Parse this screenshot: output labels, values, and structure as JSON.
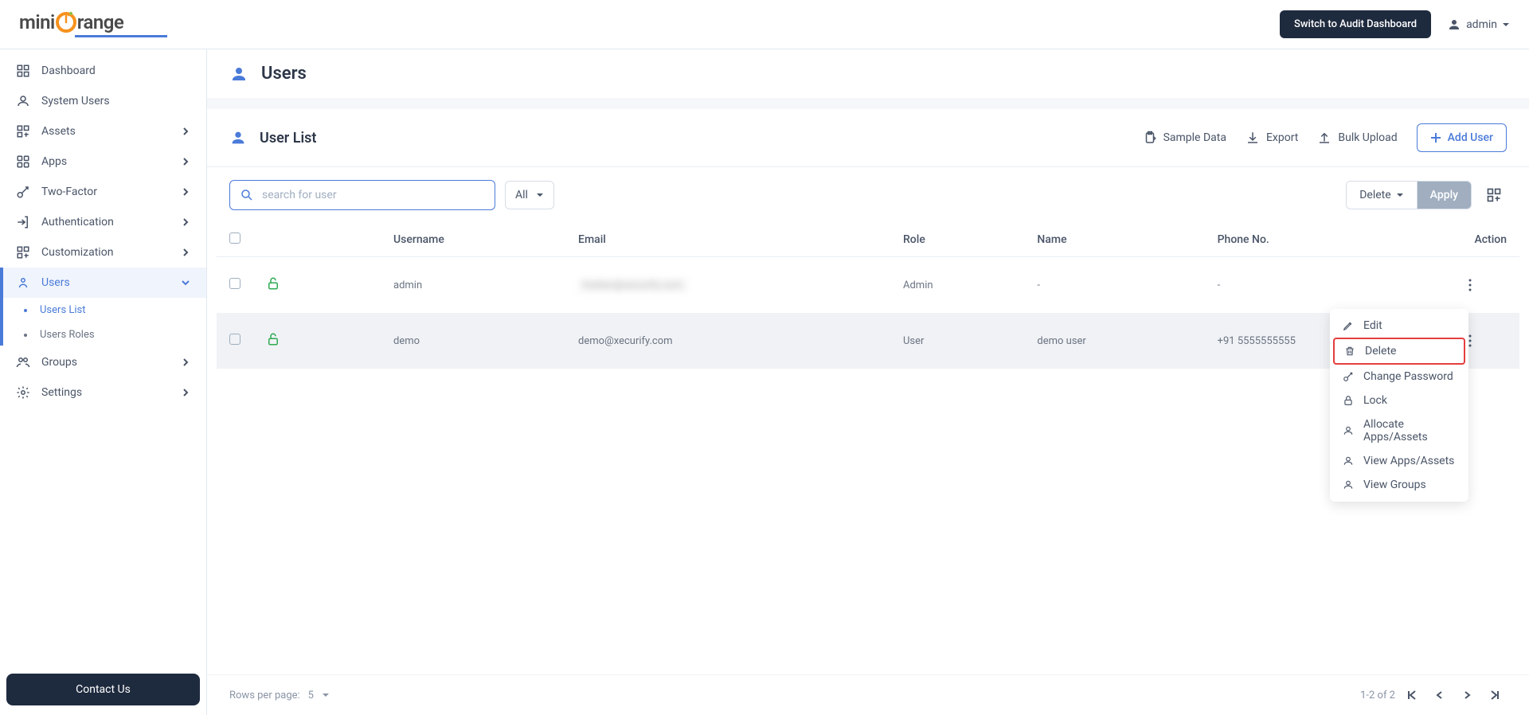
{
  "topbar": {
    "switch_label": "Switch to Audit Dashboard",
    "user_label": "admin",
    "logo_parts": {
      "a": "mini",
      "b": "range"
    }
  },
  "sidebar": {
    "items": [
      {
        "label": "Dashboard"
      },
      {
        "label": "System Users"
      },
      {
        "label": "Assets"
      },
      {
        "label": "Apps"
      },
      {
        "label": "Two-Factor"
      },
      {
        "label": "Authentication"
      },
      {
        "label": "Customization"
      },
      {
        "label": "Users"
      },
      {
        "label": "Groups"
      },
      {
        "label": "Settings"
      }
    ],
    "sub": [
      {
        "label": "Users List"
      },
      {
        "label": "Users Roles"
      }
    ],
    "contact_label": "Contact Us"
  },
  "page": {
    "title": "Users",
    "list_title": "User List",
    "sample": "Sample Data",
    "export": "Export",
    "bulk": "Bulk Upload",
    "add_user": "Add User",
    "search_placeholder": "search for user",
    "filter_all": "All",
    "bulk_delete": "Delete",
    "apply": "Apply"
  },
  "table": {
    "headers": {
      "username": "Username",
      "email": "Email",
      "role": "Role",
      "name": "Name",
      "phone": "Phone No.",
      "action": "Action"
    },
    "rows": [
      {
        "username": "admin",
        "email": "hidden@xecurify.com",
        "role": "Admin",
        "name": "-",
        "phone": "-"
      },
      {
        "username": "demo",
        "email": "demo@xecurify.com",
        "role": "User",
        "name": "demo user",
        "phone": "+91 5555555555"
      }
    ]
  },
  "ctx": {
    "edit": "Edit",
    "delete": "Delete",
    "change_pw": "Change Password",
    "lock": "Lock",
    "allocate": "Allocate Apps/Assets",
    "view_apps": "View Apps/Assets",
    "view_groups": "View Groups"
  },
  "footer": {
    "rpp_label": "Rows per page:",
    "rpp_val": "5",
    "range": "1-2 of 2"
  }
}
